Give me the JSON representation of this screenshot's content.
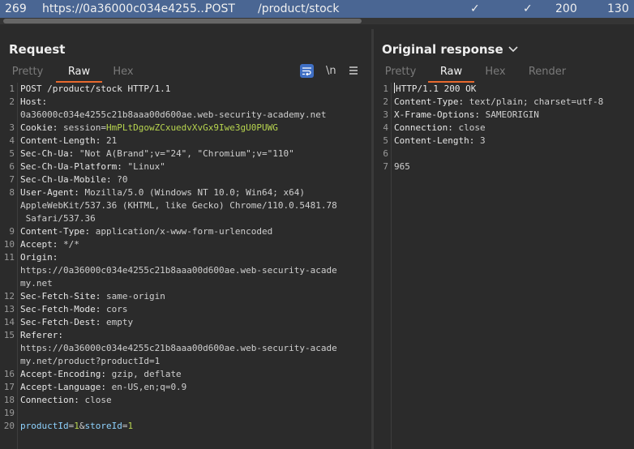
{
  "history_row": {
    "id": "269",
    "host": "https://0a36000c034e4255...",
    "method": "POST",
    "path": "/product/stock",
    "check1": "✓",
    "check2": "✓",
    "status": "200",
    "length": "130"
  },
  "request": {
    "title": "Request",
    "tabs": [
      "Pretty",
      "Raw",
      "Hex"
    ],
    "active_tab": "Raw",
    "tools": {
      "wrap_icon": "wrap-lines-icon",
      "newline": "\\n",
      "menu_icon": "hamburger-menu-icon"
    },
    "lines": [
      {
        "n": "1",
        "k": "POST /product/stock HTTP/1.1",
        "v": ""
      },
      {
        "n": "2",
        "k": "Host:",
        "v": ""
      },
      {
        "n": "",
        "k": "",
        "v": "0a36000c034e4255c21b8aaa00d600ae.web-security-academy.net"
      },
      {
        "n": "3",
        "k": "Cookie:",
        "v": " session=",
        "cookie_v": "HmPLtDgowZCxuedvXvGx9Iwe3gU0PUWG"
      },
      {
        "n": "4",
        "k": "Content-Length:",
        "v": " 21"
      },
      {
        "n": "5",
        "k": "Sec-Ch-Ua:",
        "v": " \"Not A(Brand\";v=\"24\", \"Chromium\";v=\"110\""
      },
      {
        "n": "6",
        "k": "Sec-Ch-Ua-Platform:",
        "v": " \"Linux\""
      },
      {
        "n": "7",
        "k": "Sec-Ch-Ua-Mobile:",
        "v": " ?0"
      },
      {
        "n": "8",
        "k": "User-Agent:",
        "v": " Mozilla/5.0 (Windows NT 10.0; Win64; x64)"
      },
      {
        "n": "",
        "k": "",
        "v": "AppleWebKit/537.36 (KHTML, like Gecko) Chrome/110.0.5481.78"
      },
      {
        "n": "",
        "k": "",
        "v": " Safari/537.36"
      },
      {
        "n": "9",
        "k": "Content-Type:",
        "v": " application/x-www-form-urlencoded"
      },
      {
        "n": "10",
        "k": "Accept:",
        "v": " */*"
      },
      {
        "n": "11",
        "k": "Origin:",
        "v": ""
      },
      {
        "n": "",
        "k": "",
        "v": "https://0a36000c034e4255c21b8aaa00d600ae.web-security-acade"
      },
      {
        "n": "",
        "k": "",
        "v": "my.net"
      },
      {
        "n": "12",
        "k": "Sec-Fetch-Site:",
        "v": " same-origin"
      },
      {
        "n": "13",
        "k": "Sec-Fetch-Mode:",
        "v": " cors"
      },
      {
        "n": "14",
        "k": "Sec-Fetch-Dest:",
        "v": " empty"
      },
      {
        "n": "15",
        "k": "Referer:",
        "v": ""
      },
      {
        "n": "",
        "k": "",
        "v": "https://0a36000c034e4255c21b8aaa00d600ae.web-security-acade"
      },
      {
        "n": "",
        "k": "",
        "v": "my.net/product?productId=1"
      },
      {
        "n": "16",
        "k": "Accept-Encoding:",
        "v": " gzip, deflate"
      },
      {
        "n": "17",
        "k": "Accept-Language:",
        "v": " en-US,en;q=0.9"
      },
      {
        "n": "18",
        "k": "Connection:",
        "v": " close"
      },
      {
        "n": "19",
        "k": "",
        "v": ""
      },
      {
        "n": "20",
        "k": "",
        "v": "",
        "body": [
          {
            "t": "productId",
            "c": "ck"
          },
          {
            "t": "=",
            "c": "hv"
          },
          {
            "t": "1",
            "c": "cv"
          },
          {
            "t": "&",
            "c": "hv"
          },
          {
            "t": "storeId",
            "c": "ck"
          },
          {
            "t": "=",
            "c": "hv"
          },
          {
            "t": "1",
            "c": "cv"
          }
        ]
      }
    ]
  },
  "response": {
    "title": "Original response",
    "tabs": [
      "Pretty",
      "Raw",
      "Hex",
      "Render"
    ],
    "active_tab": "Raw",
    "lines": [
      {
        "n": "1",
        "k": "HTTP/1.1 200 OK",
        "v": ""
      },
      {
        "n": "2",
        "k": "Content-Type:",
        "v": " text/plain; charset=utf-8"
      },
      {
        "n": "3",
        "k": "X-Frame-Options:",
        "v": " SAMEORIGIN"
      },
      {
        "n": "4",
        "k": "Connection:",
        "v": " close"
      },
      {
        "n": "5",
        "k": "Content-Length:",
        "v": " 3"
      },
      {
        "n": "6",
        "k": "",
        "v": ""
      },
      {
        "n": "7",
        "k": "",
        "v": "965"
      }
    ]
  }
}
